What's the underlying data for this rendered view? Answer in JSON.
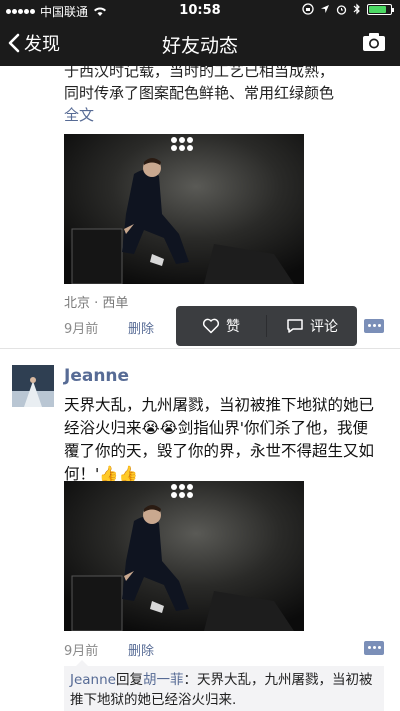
{
  "status_bar": {
    "carrier": "中国联通",
    "time": "10:58"
  },
  "nav": {
    "back_label": "发现",
    "title": "好友动态"
  },
  "post1": {
    "text_lines": [
      "于西汉时记载，当时的工艺已相当成熟，",
      "同时传承了图案配色鲜艳、常用红绿颜色"
    ],
    "full_text_label": "全文",
    "location": "北京 · 西单",
    "time": "9月前",
    "delete_label": "删除"
  },
  "popup": {
    "like_label": "赞",
    "comment_label": "评论"
  },
  "post2": {
    "author": "Jeanne",
    "text": "天界大乱，九州屠戮，当初被推下地狱的她已经浴火归来😭😭剑指仙界'你们杀了他，我便覆了你的天，毁了你的界，永世不得超生又如何！'👍👍",
    "time": "9月前",
    "delete_label": "删除",
    "comment": {
      "author": "Jeanne",
      "reply_word": "回复",
      "target": "胡一菲",
      "text": "：天界大乱，九州屠戮，当初被推下地狱的她已经浴火归来."
    }
  },
  "colors": {
    "link": "#576b95",
    "nav_bg": "#1b1b1b",
    "battery": "#4cd964"
  }
}
